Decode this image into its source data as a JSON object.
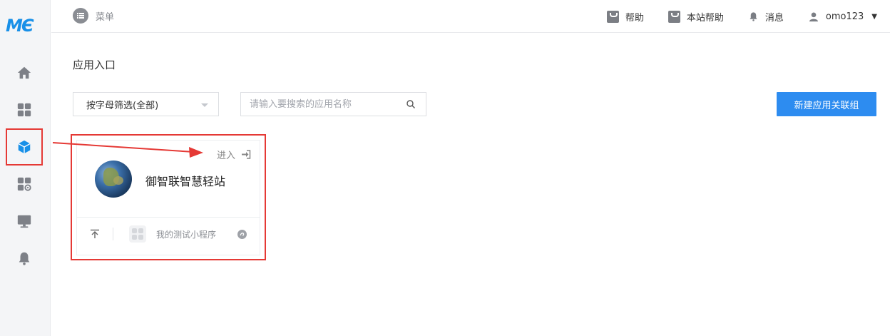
{
  "sidebar": {
    "logo": "MЄ",
    "items": [
      {
        "icon": "home-icon"
      },
      {
        "icon": "grid-icon"
      },
      {
        "icon": "cube-icon"
      },
      {
        "icon": "grid-gear-icon"
      },
      {
        "icon": "monitor-icon"
      },
      {
        "icon": "bell-icon"
      }
    ]
  },
  "topbar": {
    "menu_label": "菜单",
    "help_label": "帮助",
    "site_help_label": "本站帮助",
    "messages_label": "消息",
    "username": "omo123"
  },
  "main": {
    "title": "应用入口",
    "filter_label": "按字母筛选(全部)",
    "search_placeholder": "请输入要搜索的应用名称",
    "new_button_label": "新建应用关联组",
    "card": {
      "enter_label": "进入",
      "app_name": "御智联智慧轻站",
      "mini_program_label": "我的测试小程序"
    }
  },
  "colors": {
    "accent": "#2d8cf0",
    "highlight": "#e53935",
    "sidebar_active": "#1890e8"
  }
}
